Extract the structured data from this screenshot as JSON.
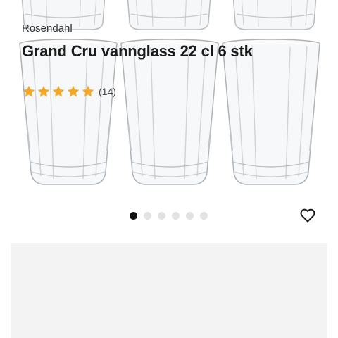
{
  "product": {
    "brand": "Rosendahl",
    "name": "Grand Cru vannglass 22 cl 6 stk",
    "rating": 5,
    "rating_max": 5,
    "review_count": "(14)"
  },
  "gallery": {
    "image_count": 6,
    "active_index": 0,
    "icons": {
      "favorite": "heart-outline-icon",
      "star": "star-icon"
    }
  },
  "colors": {
    "active_dot": "#111111",
    "inactive_dot": "#e2e2e2",
    "card_background": "#f3f3f3",
    "star": "#f5a623"
  }
}
